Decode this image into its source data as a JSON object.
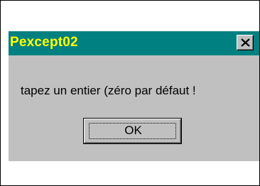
{
  "dialog": {
    "title": "Pexcept02",
    "close_icon": "close-x-icon",
    "message": "tapez un entier (zéro par défaut !",
    "ok_label": "OK"
  },
  "colors": {
    "titlebar": "#008080",
    "title_text": "#ffff00",
    "dialog_face": "#c0c0c0"
  }
}
